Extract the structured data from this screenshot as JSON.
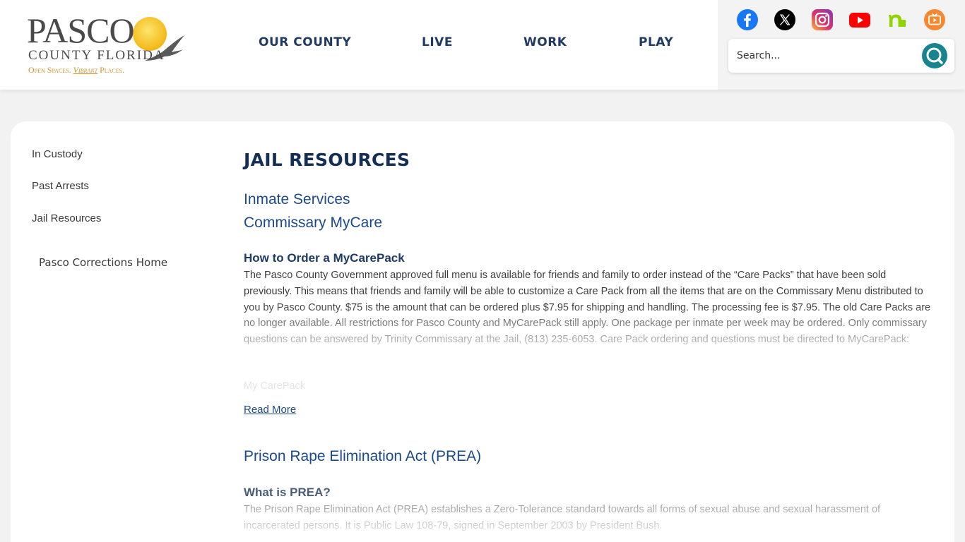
{
  "header": {
    "logo": {
      "title": "PASCO",
      "subtitle": "COUNTY FLORIDA",
      "tagline_part1": "Open Spaces.",
      "tagline_part2": "Vibrant",
      "tagline_part3": "Places."
    },
    "nav": [
      {
        "label": "OUR COUNTY"
      },
      {
        "label": "LIVE"
      },
      {
        "label": "WORK"
      },
      {
        "label": "PLAY"
      }
    ],
    "social": [
      {
        "icon": "facebook-icon",
        "color": "#1877f2"
      },
      {
        "icon": "x-twitter-icon",
        "color": "#000000"
      },
      {
        "icon": "instagram-icon",
        "color": "#d6249f"
      },
      {
        "icon": "youtube-icon",
        "color": "#ff0000"
      },
      {
        "icon": "nextdoor-icon",
        "color": "#8ed500"
      },
      {
        "icon": "tv-icon",
        "color": "#f7882f"
      }
    ],
    "search": {
      "placeholder": "Search...",
      "button_color": "#16858f"
    }
  },
  "sidebar": {
    "items": [
      {
        "label": "In Custody"
      },
      {
        "label": "Past Arrests"
      },
      {
        "label": "Jail Resources"
      }
    ],
    "home_link": "Pasco Corrections Home"
  },
  "main": {
    "title": "JAIL RESOURCES",
    "links": [
      {
        "label": "Inmate Services"
      },
      {
        "label": "Commissary MyCare"
      }
    ],
    "section1": {
      "heading": "How to Order a MyCarePack",
      "body": "The Pasco County Government approved full menu is available for friends and family to order instead of the “Care Packs” that have been sold previously. This means that friends and family will be able to customize a Care Pack from all the items that are on the Commissary Menu distributed to you by Pasco County. $75 is the amount that can be ordered plus $7.95 for shipping and handling. The processing fee is $7.95. The old Care Packs are no longer available. All restrictions for Pasco County and MyCarePack still apply. One package per inmate per week may be ordered. Only commissary questions can be answered by Trinity Commissary at the Jail, (813) 235-6053. Care Pack ordering and questions must be directed to MyCarePack:",
      "faint_line": "My CarePack",
      "read_more": "Read More"
    },
    "section2": {
      "title": "Prison Rape Elimination Act (PREA)",
      "heading": "What is PREA?",
      "body": "The Prison Rape Elimination Act (PREA) establishes a Zero-Tolerance standard towards all forms of sexual abuse and sexual harassment of incarcerated persons. It is Public Law 108-79, signed in September 2003 by President Bush."
    }
  }
}
